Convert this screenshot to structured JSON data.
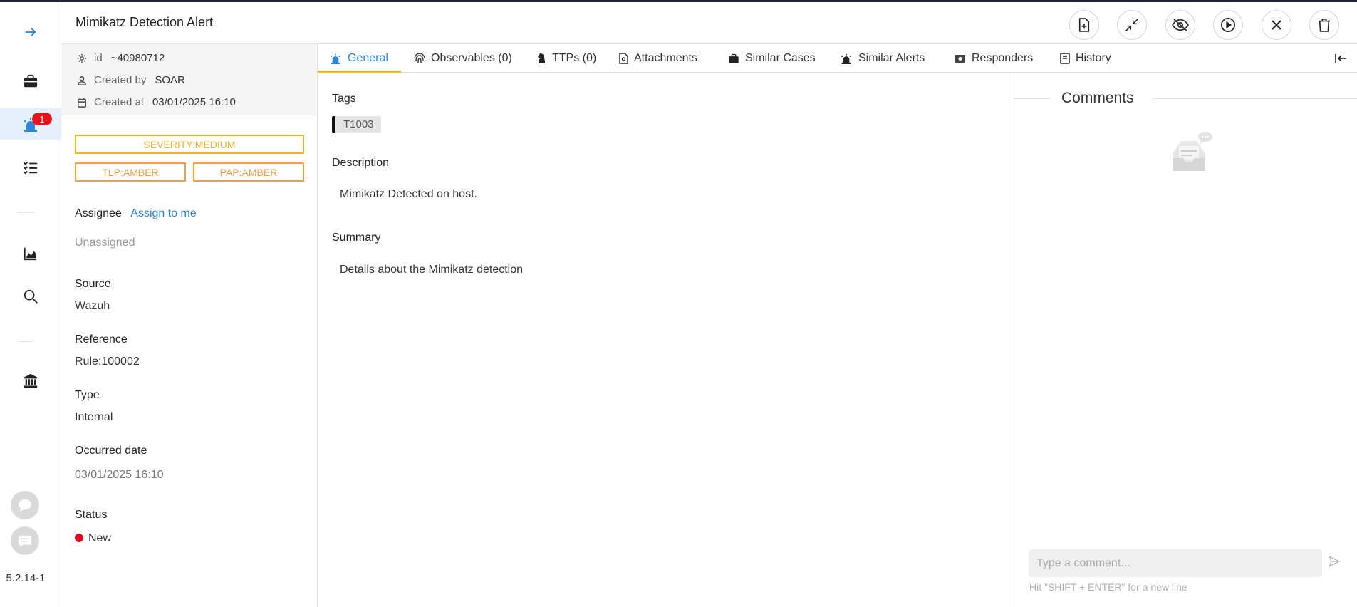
{
  "header": {
    "title": "Mimikatz Detection Alert",
    "actions": [
      {
        "name": "add-to-case",
        "icon": "file-plus-icon"
      },
      {
        "name": "merge",
        "icon": "compress-arrows-icon"
      },
      {
        "name": "ignore",
        "icon": "eye-off-icon"
      },
      {
        "name": "run",
        "icon": "play-circle-icon"
      },
      {
        "name": "close",
        "icon": "close-icon"
      },
      {
        "name": "delete",
        "icon": "trash-icon"
      }
    ]
  },
  "nav": {
    "items": [
      {
        "name": "expand",
        "icon": "arrow-right-icon"
      },
      {
        "name": "cases",
        "icon": "briefcase-icon"
      },
      {
        "name": "alerts",
        "icon": "siren-icon",
        "badge": "1",
        "active": true
      },
      {
        "name": "tasks",
        "icon": "checklist-icon"
      },
      {
        "name": "dashboards",
        "icon": "area-chart-icon"
      },
      {
        "name": "search",
        "icon": "search-icon"
      },
      {
        "name": "organisation",
        "icon": "bank-icon"
      }
    ],
    "version": "5.2.14-1"
  },
  "details": {
    "id_label": "id",
    "id_value": "~40980712",
    "created_by_label": "Created by",
    "created_by_value": "SOAR",
    "created_at_label": "Created at",
    "created_at_value": "03/01/2025 16:10",
    "severity": "SEVERITY:MEDIUM",
    "tlp": "TLP:AMBER",
    "pap": "PAP:AMBER",
    "assignee_label": "Assignee",
    "assign_to_me": "Assign to me",
    "assignee_value": "Unassigned",
    "source_label": "Source",
    "source_value": "Wazuh",
    "reference_label": "Reference",
    "reference_value": "Rule:100002",
    "type_label": "Type",
    "type_value": "Internal",
    "occurred_label": "Occurred date",
    "occurred_value": "03/01/2025 16:10",
    "status_label": "Status",
    "status_value": "New",
    "status_color": "#d90d1f"
  },
  "tabs": [
    {
      "label": "General",
      "icon": "siren-icon",
      "active": true
    },
    {
      "label": "Observables (0)",
      "icon": "fingerprint-icon"
    },
    {
      "label": "TTPs (0)",
      "icon": "chess-knight-icon"
    },
    {
      "label": "Attachments",
      "icon": "file-icon"
    },
    {
      "label": "Similar Cases",
      "icon": "briefcase-icon"
    },
    {
      "label": "Similar Alerts",
      "icon": "siren-icon"
    },
    {
      "label": "Responders",
      "icon": "camera-box-icon"
    },
    {
      "label": "History",
      "icon": "book-icon"
    }
  ],
  "general": {
    "tags_label": "Tags",
    "tags": [
      "T1003"
    ],
    "description_label": "Description",
    "description": "Mimikatz Detected on host.",
    "summary_label": "Summary",
    "summary": "Details about the Mimikatz detection"
  },
  "comments": {
    "title": "Comments",
    "placeholder": "Type a comment...",
    "hint": "Hit \"SHIFT + ENTER\" for a new line"
  },
  "colors": {
    "accent": "#2a85d8",
    "severity_medium": "#f0b429",
    "amber": "#f59e42",
    "badge": "#e5151f"
  }
}
